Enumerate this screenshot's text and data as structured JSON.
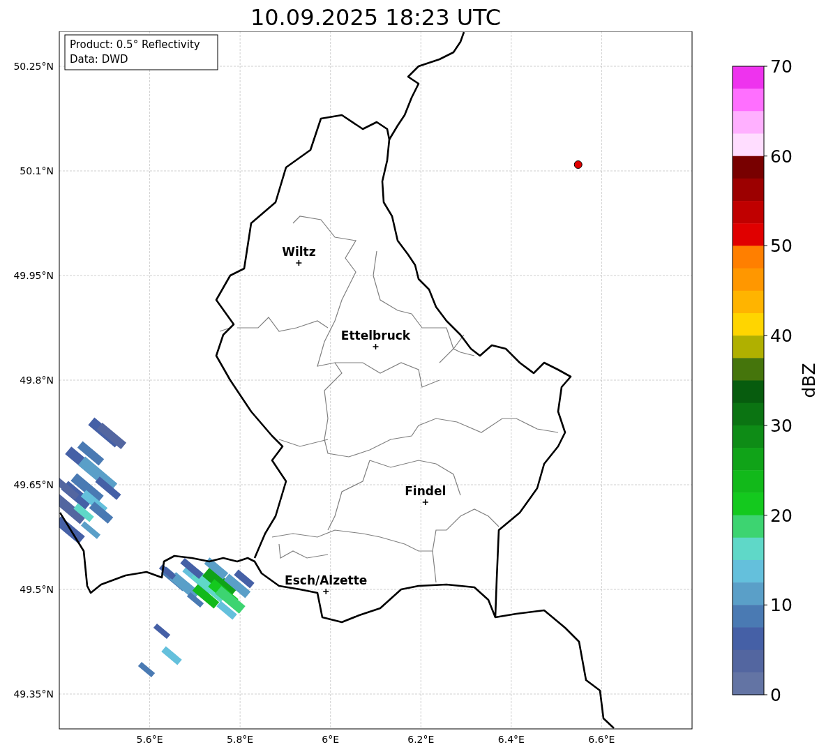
{
  "title": "10.09.2025 18:23 UTC",
  "map": {
    "info_box": [
      "Product: 0.5° Reflectivity",
      "Data: DWD"
    ],
    "y_axis_labels": [
      "50.25°N",
      "50.1°N",
      "49.95°N",
      "49.8°N",
      "49.65°N",
      "49.5°N",
      "49.35°N"
    ],
    "x_axis_labels": [
      "5.6°E",
      "5.8°E",
      "6°E",
      "6.2°E",
      "6.4°E",
      "6.6°E"
    ],
    "cities": [
      {
        "name": "Wiltz"
      },
      {
        "name": "Ettelbruck"
      },
      {
        "name": "Findel"
      },
      {
        "name": "Esch/Alzette"
      }
    ]
  },
  "colorbar": {
    "label": "dBZ",
    "ticks": [
      "70",
      "60",
      "50",
      "40",
      "30",
      "20",
      "10",
      "0"
    ],
    "bins": [
      {
        "color": "#ee33ee"
      },
      {
        "color": "#ff6fff"
      },
      {
        "color": "#ffb0ff"
      },
      {
        "color": "#ffddff"
      },
      {
        "color": "#780000"
      },
      {
        "color": "#9c0000"
      },
      {
        "color": "#c00000"
      },
      {
        "color": "#e00000"
      },
      {
        "color": "#ff7f00"
      },
      {
        "color": "#ff9700"
      },
      {
        "color": "#ffb400"
      },
      {
        "color": "#ffd500"
      },
      {
        "color": "#b0b000"
      },
      {
        "color": "#45750c"
      },
      {
        "color": "#075c0e"
      },
      {
        "color": "#0b7412"
      },
      {
        "color": "#0e8c16"
      },
      {
        "color": "#10a318"
      },
      {
        "color": "#12b91a"
      },
      {
        "color": "#14c91e"
      },
      {
        "color": "#3dd471"
      },
      {
        "color": "#5fd8c8"
      },
      {
        "color": "#64c0dc"
      },
      {
        "color": "#5a9fc8"
      },
      {
        "color": "#4a7ab3"
      },
      {
        "color": "#4560a6"
      },
      {
        "color": "#5366a0"
      },
      {
        "color": "#6374a4"
      }
    ]
  }
}
